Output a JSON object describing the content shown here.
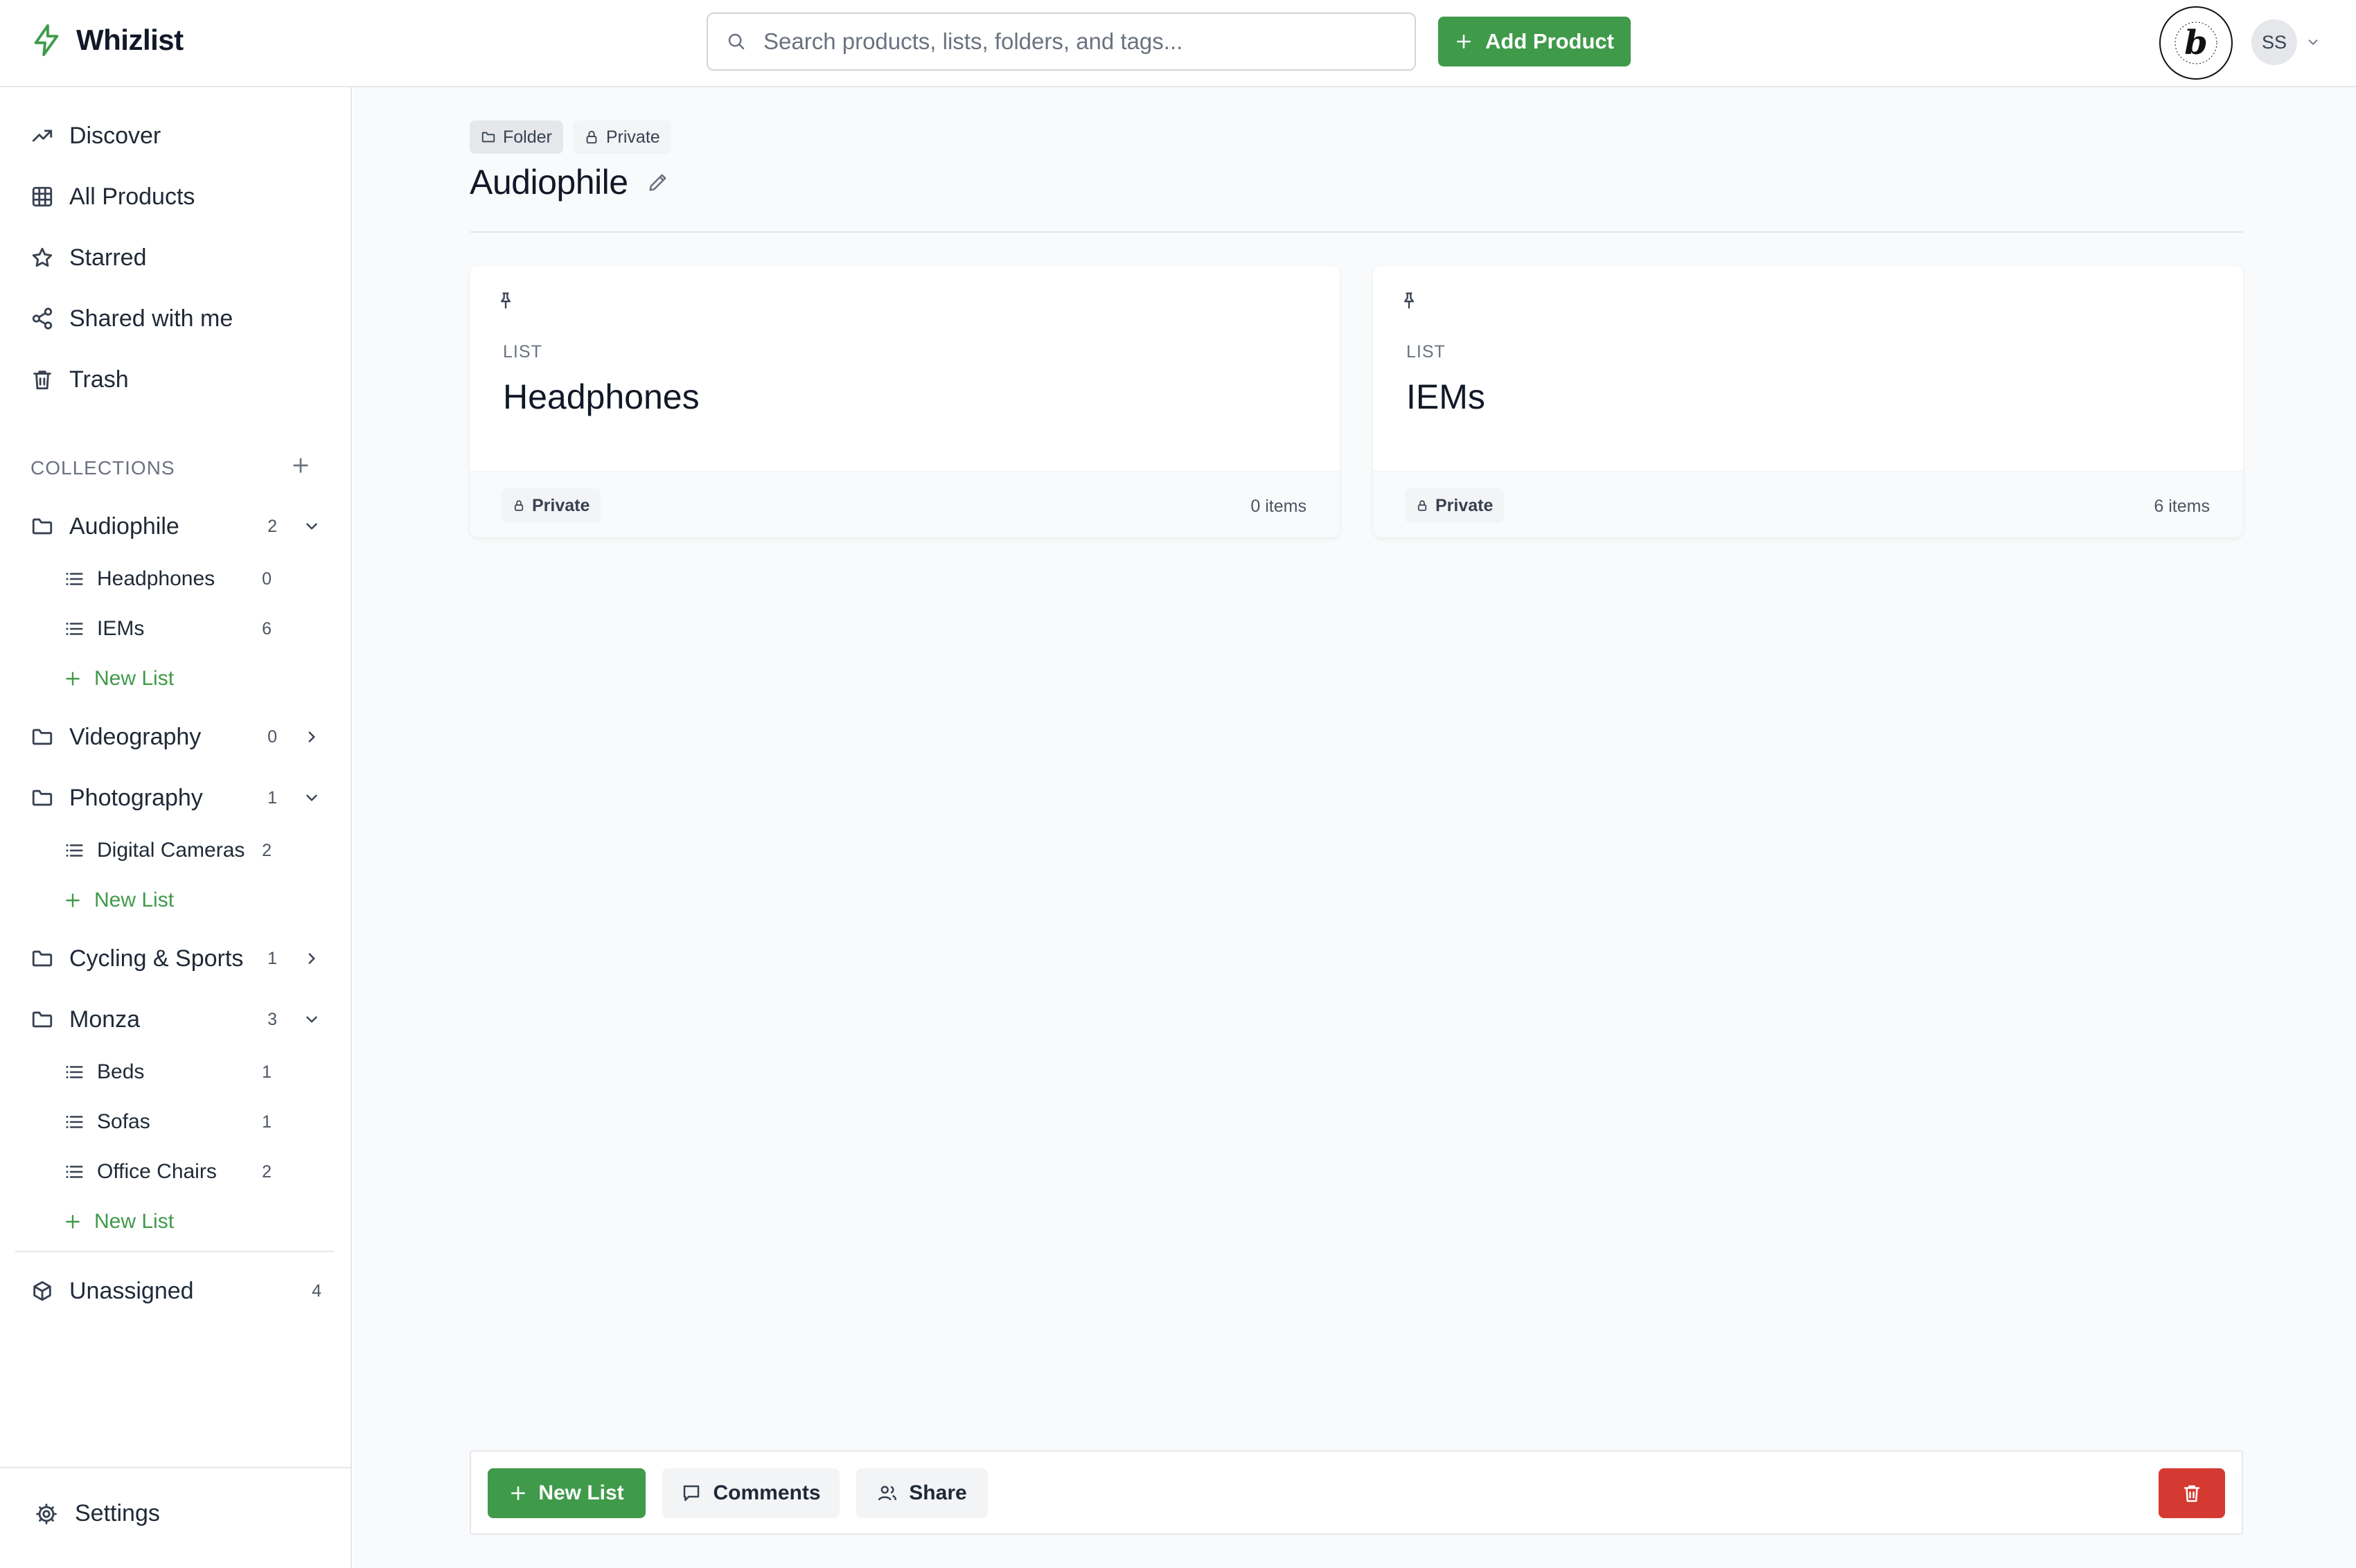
{
  "app": {
    "name": "Whizlist"
  },
  "header": {
    "search_placeholder": "Search products, lists, folders, and tags...",
    "add_product_label": "Add Product",
    "avatar_initials": "SS"
  },
  "sidebar": {
    "nav": [
      {
        "label": "Discover",
        "icon": "trending-up-icon"
      },
      {
        "label": "All Products",
        "icon": "grid-icon"
      },
      {
        "label": "Starred",
        "icon": "star-icon"
      },
      {
        "label": "Shared with me",
        "icon": "share-icon"
      },
      {
        "label": "Trash",
        "icon": "trash-icon"
      }
    ],
    "collections_title": "COLLECTIONS",
    "folders": [
      {
        "label": "Audiophile",
        "count": "2",
        "expanded": true,
        "lists": [
          {
            "label": "Headphones",
            "count": "0"
          },
          {
            "label": "IEMs",
            "count": "6"
          }
        ]
      },
      {
        "label": "Videography",
        "count": "0",
        "expanded": false,
        "lists": []
      },
      {
        "label": "Photography",
        "count": "1",
        "expanded": true,
        "lists": [
          {
            "label": "Digital Cameras",
            "count": "2"
          }
        ]
      },
      {
        "label": "Cycling & Sports",
        "count": "1",
        "expanded": false,
        "lists": []
      },
      {
        "label": "Monza",
        "count": "3",
        "expanded": true,
        "lists": [
          {
            "label": "Beds",
            "count": "1"
          },
          {
            "label": "Sofas",
            "count": "1"
          },
          {
            "label": "Office Chairs",
            "count": "2"
          }
        ]
      }
    ],
    "new_list_label": "New List",
    "unassigned": {
      "label": "Unassigned",
      "count": "4"
    },
    "settings_label": "Settings"
  },
  "main": {
    "crumbs": {
      "folder": "Folder",
      "private": "Private"
    },
    "title": "Audiophile",
    "cards": [
      {
        "type": "LIST",
        "name": "Headphones",
        "visibility": "Private",
        "items": "0 items"
      },
      {
        "type": "LIST",
        "name": "IEMs",
        "visibility": "Private",
        "items": "6 items"
      }
    ],
    "actions": {
      "new_list": "New List",
      "comments": "Comments",
      "share": "Share"
    }
  },
  "colors": {
    "accent": "#3f9a4a",
    "danger": "#d43a32"
  }
}
